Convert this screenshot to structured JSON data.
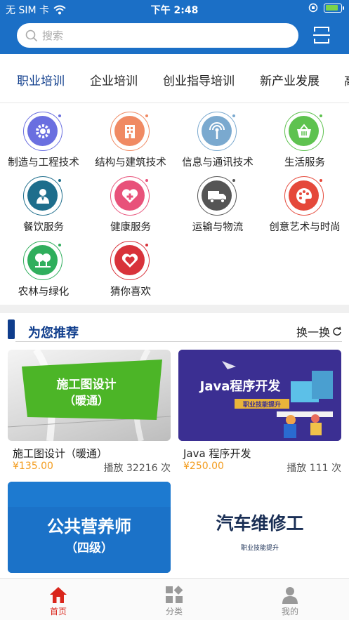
{
  "status_bar": {
    "carrier": "无 SIM 卡",
    "time": "下午 2:48",
    "battery_level": 0.85
  },
  "search": {
    "placeholder": "搜索"
  },
  "tabs": [
    {
      "label": "职业培训",
      "active": true
    },
    {
      "label": "企业培训"
    },
    {
      "label": "创业指导培训"
    },
    {
      "label": "新产业发展"
    },
    {
      "label": "高"
    }
  ],
  "categories": [
    {
      "label": "制造与工程技术",
      "icon": "gear-icon",
      "color": "#6a6fe0"
    },
    {
      "label": "结构与建筑技术",
      "icon": "building-icon",
      "color": "#f08a63"
    },
    {
      "label": "信息与通讯技术",
      "icon": "antenna-icon",
      "color": "#7aa9cf"
    },
    {
      "label": "生活服务",
      "icon": "basket-icon",
      "color": "#5ec24f"
    },
    {
      "label": "餐饮服务",
      "icon": "chef-icon",
      "color": "#1e6e8c"
    },
    {
      "label": "健康服务",
      "icon": "health-heart-icon",
      "color": "#e8527a"
    },
    {
      "label": "运输与物流",
      "icon": "truck-icon",
      "color": "#555555"
    },
    {
      "label": "创意艺术与时尚",
      "icon": "palette-icon",
      "color": "#e5483a"
    },
    {
      "label": "农林与绿化",
      "icon": "tree-icon",
      "color": "#2fae5c"
    },
    {
      "label": "猜你喜欢",
      "icon": "heart-icon",
      "color": "#d8323a"
    }
  ],
  "recommend": {
    "title": "为您推荐",
    "refresh_label": "换一换"
  },
  "courses": [
    {
      "title": "施工图设计（暖通）",
      "price": "¥135.00",
      "plays": "播放 32216 次",
      "banner_lines": [
        "施工图设计",
        "（暖通）"
      ]
    },
    {
      "title": "Java 程序开发",
      "price": "¥250.00",
      "plays": "播放 111 次",
      "banner_title": "Java程序开发",
      "banner_sub": "职业技能提升"
    },
    {
      "banner_lines": [
        "公共营养师",
        "（四级）"
      ]
    },
    {
      "banner_title": "汽车维修工",
      "banner_sub": "职业技能提升"
    }
  ],
  "bottom_nav": [
    {
      "label": "首页",
      "icon": "home-icon",
      "active": true
    },
    {
      "label": "分类",
      "icon": "category-icon"
    },
    {
      "label": "我的",
      "icon": "profile-icon"
    }
  ],
  "colors": {
    "brand": "#1b6fc6",
    "active_tab": "#0f3d8c",
    "price": "#f39c1e",
    "nav_active": "#d9261c"
  }
}
